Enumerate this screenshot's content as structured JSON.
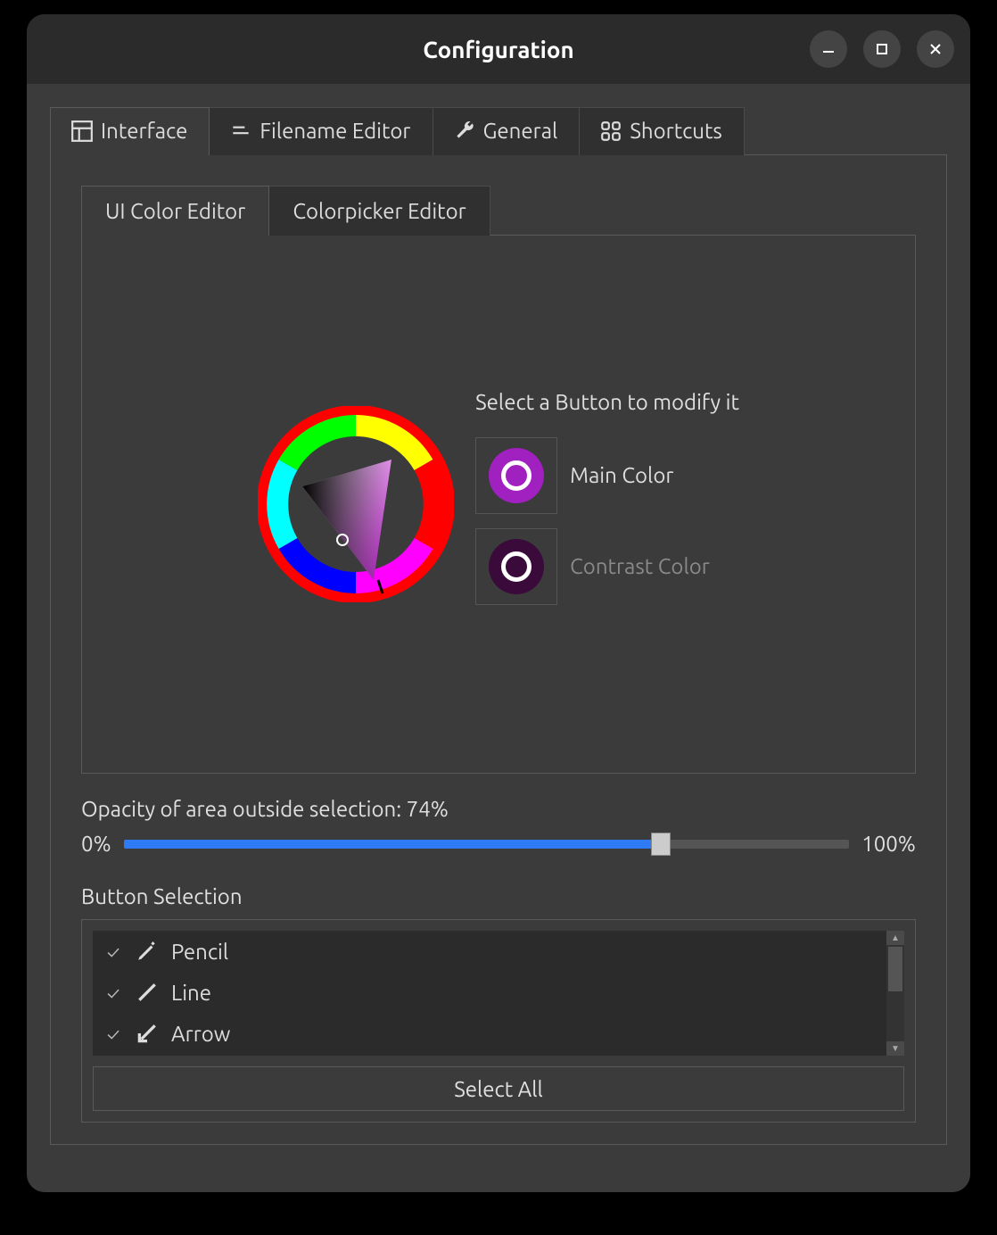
{
  "window": {
    "title": "Configuration"
  },
  "tabs": {
    "interface": "Interface",
    "filename": "Filename Editor",
    "general": "General",
    "shortcuts": "Shortcuts"
  },
  "subtabs": {
    "ui_color": "UI Color Editor",
    "colorpicker": "Colorpicker Editor"
  },
  "color_editor": {
    "instruction": "Select a Button to modify it",
    "main_label": "Main Color",
    "main_color": "#a020c0",
    "contrast_label": "Contrast Color",
    "contrast_color": "#3a0a3a"
  },
  "opacity": {
    "label": "Opacity of area outside selection: 74%",
    "value": 74,
    "min_label": "0%",
    "max_label": "100%"
  },
  "button_selection": {
    "heading": "Button Selection",
    "items": [
      {
        "label": "Pencil",
        "checked": true,
        "icon": "pencil"
      },
      {
        "label": "Line",
        "checked": true,
        "icon": "line"
      },
      {
        "label": "Arrow",
        "checked": true,
        "icon": "arrow"
      }
    ],
    "select_all": "Select All"
  }
}
